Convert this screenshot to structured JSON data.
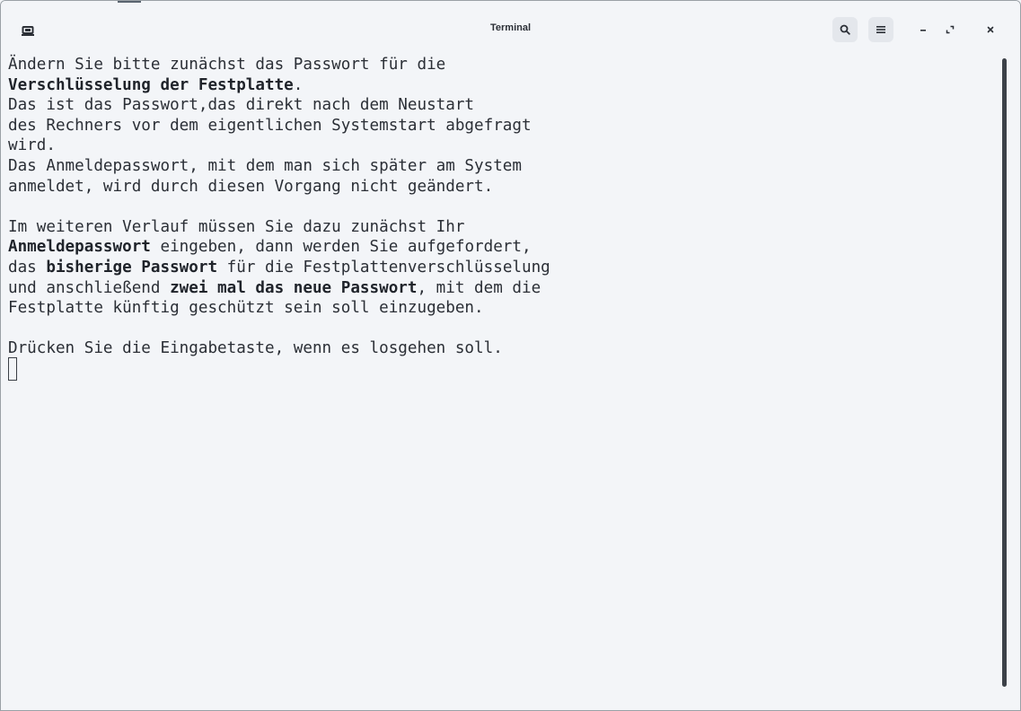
{
  "window": {
    "title": "Terminal",
    "icons": {
      "app": "terminal-icon",
      "search": "search-icon",
      "menu": "hamburger-menu-icon",
      "minimize": "minimize-icon",
      "maximize": "maximize-icon",
      "close": "close-icon"
    }
  },
  "terminal": {
    "lines": [
      [
        {
          "t": "Ändern Sie bitte zunächst das Passwort für die",
          "b": false
        }
      ],
      [
        {
          "t": "Verschlüsselung der Festplatte",
          "b": true
        },
        {
          "t": ".",
          "b": false
        }
      ],
      [
        {
          "t": "Das ist das Passwort,das direkt nach dem Neustart",
          "b": false
        }
      ],
      [
        {
          "t": "des Rechners vor dem eigentlichen Systemstart abgefragt",
          "b": false
        }
      ],
      [
        {
          "t": "wird.",
          "b": false
        }
      ],
      [
        {
          "t": "Das Anmeldepasswort, mit dem man sich später am System",
          "b": false
        }
      ],
      [
        {
          "t": "anmeldet, wird durch diesen Vorgang nicht geändert.",
          "b": false
        }
      ],
      [],
      [
        {
          "t": "Im weiteren Verlauf müssen Sie dazu zunächst Ihr",
          "b": false
        }
      ],
      [
        {
          "t": "Anmeldepasswort",
          "b": true
        },
        {
          "t": " eingeben, dann werden Sie aufgefordert,",
          "b": false
        }
      ],
      [
        {
          "t": "das ",
          "b": false
        },
        {
          "t": "bisherige Passwort",
          "b": true
        },
        {
          "t": " für die Festplattenverschlüsselung",
          "b": false
        }
      ],
      [
        {
          "t": "und anschließend ",
          "b": false
        },
        {
          "t": "zwei mal das neue Passwort",
          "b": true
        },
        {
          "t": ", mit dem die",
          "b": false
        }
      ],
      [
        {
          "t": "Festplatte künftig geschützt sein soll einzugeben.",
          "b": false
        }
      ],
      [],
      [
        {
          "t": "Drücken Sie die Eingabetaste, wenn es losgehen soll.",
          "b": false
        }
      ]
    ]
  }
}
